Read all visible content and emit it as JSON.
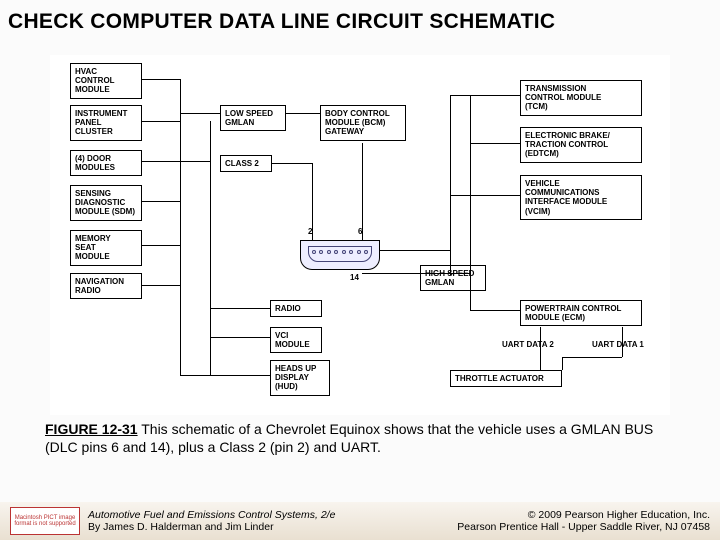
{
  "title": "CHECK COMPUTER DATA LINE CIRCUIT SCHEMATIC",
  "caption": {
    "fig": "FIGURE 12-31",
    "text": " This schematic of a Chevrolet Equinox shows that the vehicle uses a GMLAN BUS (DLC pins 6 and 14), plus a Class 2 (pin 2) and UART."
  },
  "footer": {
    "thumb": "Macintosh PICT image format is not supported",
    "book_title": "Automotive Fuel and Emissions Control Systems, 2/e",
    "authors": "By James D. Halderman and Jim Linder",
    "copyright": "© 2009 Pearson Higher Education, Inc.",
    "publisher": "Pearson Prentice Hall - Upper Saddle River, NJ 07458"
  },
  "nodes": {
    "hvac": "HVAC\nCONTROL\nMODULE",
    "ipc": "INSTRUMENT\nPANEL\nCLUSTER",
    "door": "(4) DOOR\nMODULES",
    "sdm": "SENSING\nDIAGNOSTIC\nMODULE (SDM)",
    "mem": "MEMORY\nSEAT\nMODULE",
    "nav": "NAVIGATION\nRADIO",
    "low": "LOW SPEED\nGMLAN",
    "class2": "CLASS 2",
    "bcm": "BODY CONTROL\nMODULE (BCM)\nGATEWAY",
    "radio": "RADIO",
    "vci": "VCI\nMODULE",
    "hud": "HEADS UP\nDISPLAY\n(HUD)",
    "high": "HIGH SPEED\nGMLAN",
    "tcm": "TRANSMISSION\nCONTROL MODULE\n(TCM)",
    "edtcm": "ELECTRONIC BRAKE/\nTRACTION CONTROL\n(EDTCM)",
    "vcim": "VEHICLE\nCOMMUNICATIONS\nINTERFACE MODULE\n(VCIM)",
    "ecm": "POWERTRAIN CONTROL\nMODULE (ECM)",
    "throttle": "THROTTLE ACTUATOR",
    "uart2": "UART DATA 2",
    "uart1": "UART DATA 1"
  },
  "pins": {
    "p2": "2",
    "p6": "6",
    "p14": "14"
  }
}
